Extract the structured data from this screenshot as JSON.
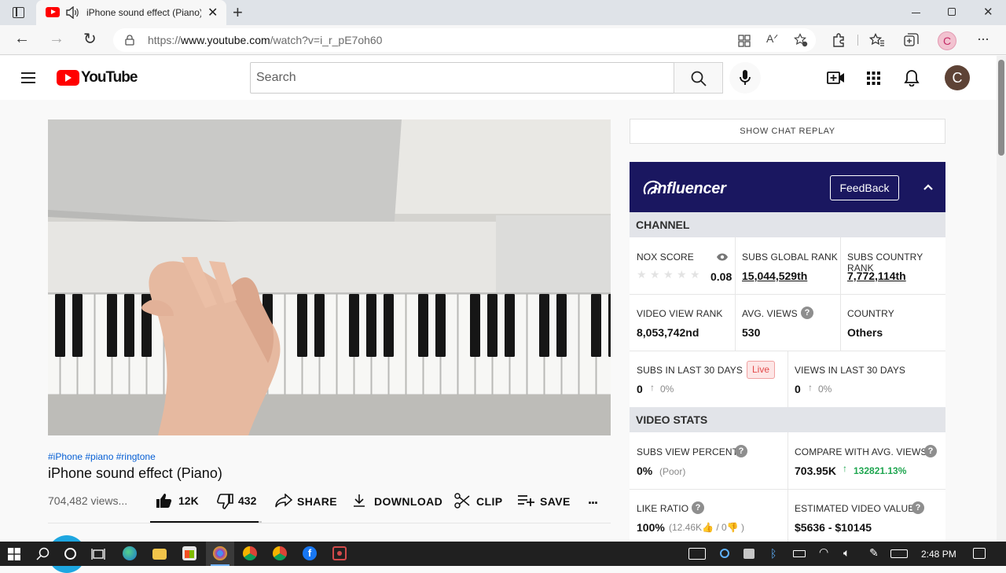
{
  "browser": {
    "tab_title": "iPhone sound effect (Piano)",
    "url_prefix": "https://",
    "url_domain": "www.youtube.com",
    "url_path": "/watch?v=i_r_pE7oh60",
    "profile_initial": "C",
    "accent_color": "#d6336c"
  },
  "youtube": {
    "logo_text": "YouTube",
    "search_placeholder": "Search",
    "avatar_initial": "C"
  },
  "video": {
    "hashtags": "#iPhone #piano #ringtone",
    "title": "iPhone sound effect (Piano)",
    "views": "704,482 views...",
    "like_count": "12K",
    "dislike_count": "432",
    "like_fill_fraction": 0.97,
    "share_label": "SHARE",
    "download_label": "DOWNLOAD",
    "clip_label": "CLIP",
    "save_label": "SAVE",
    "more_label": "..."
  },
  "chat": {
    "show_replay_label": "SHOW CHAT REPLAY"
  },
  "influencer": {
    "brand": "influencer",
    "feedback_label": "FeedBack",
    "header_color": "#1a1760",
    "channel_section": "CHANNEL",
    "nox_score_label": "NOX SCORE",
    "nox_score_value": "0.08",
    "nox_stars_filled": 0,
    "subs_global_rank_label": "SUBS GLOBAL RANK",
    "subs_global_rank_value": "15,044,529th",
    "subs_country_rank_label": "SUBS COUNTRY RANK",
    "subs_country_rank_value": "7,772,114th",
    "video_view_rank_label": "VIDEO VIEW RANK",
    "video_view_rank_value": "8,053,742nd",
    "avg_views_label": "AVG. VIEWS",
    "avg_views_value": "530",
    "country_label": "COUNTRY",
    "country_value": "Others",
    "subs_30_label": "SUBS IN LAST 30 DAYS",
    "live_badge": "Live",
    "subs_30_value": "0",
    "subs_30_pct": "0%",
    "views_30_label": "VIEWS IN LAST 30 DAYS",
    "views_30_value": "0",
    "views_30_pct": "0%",
    "video_stats_section": "VIDEO STATS",
    "subs_view_percent_label": "SUBS VIEW PERCENT",
    "subs_view_percent_value": "0%",
    "subs_view_percent_rating": "(Poor)",
    "compare_label": "COMPARE WITH AVG. VIEWS",
    "compare_value": "703.95K",
    "compare_change": "132821.13%",
    "like_ratio_label": "LIKE RATIO",
    "like_ratio_value": "100%",
    "like_ratio_likes": "(12.46K",
    "like_ratio_dislikes": "/ 0",
    "like_ratio_close": ")",
    "est_value_label": "ESTIMATED VIDEO VALUE",
    "est_value_value": "$5636 - $10145"
  },
  "taskbar": {
    "time": "2:48 PM"
  }
}
